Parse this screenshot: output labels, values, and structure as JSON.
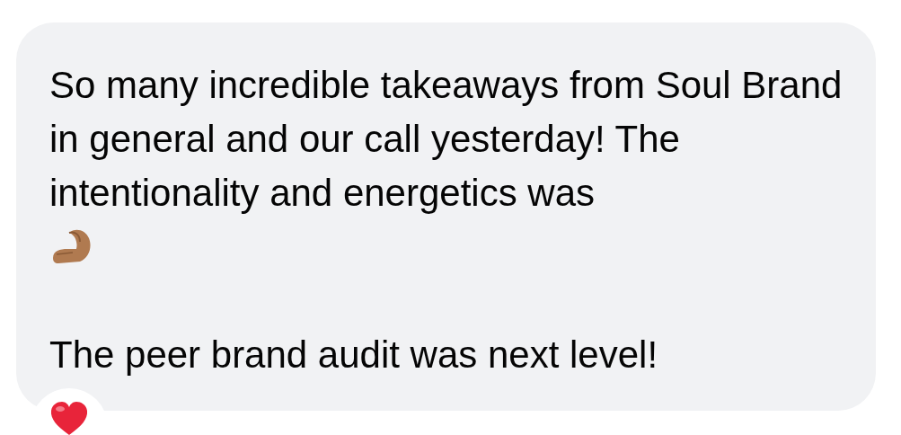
{
  "message": {
    "paragraphs": [
      "So many incredible takeaways from Soul Brand in general and our call yesterday! The intentionality and energetics was",
      "The peer brand audit was next level!"
    ],
    "reaction": {
      "kind": "heart"
    }
  }
}
